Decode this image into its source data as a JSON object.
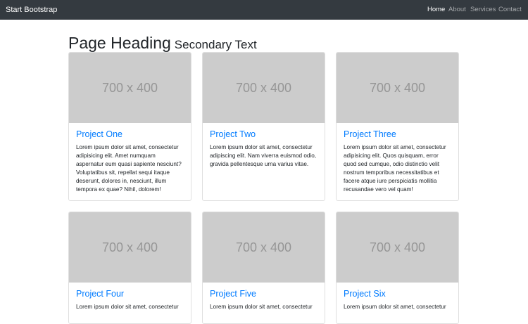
{
  "navbar": {
    "brand": "Start Bootstrap",
    "links": [
      {
        "label": "Home",
        "active": true
      },
      {
        "label": "About",
        "active": false
      },
      {
        "label": "Services",
        "active": false
      },
      {
        "label": "Contact",
        "active": false
      }
    ]
  },
  "page": {
    "heading": "Page Heading",
    "secondary": "Secondary Text"
  },
  "cards": [
    {
      "image_label": "700 x 400",
      "title": "Project One",
      "text": "Lorem ipsum dolor sit amet, consectetur adipisicing elit. Amet numquam aspernatur eum quasi sapiente nesciunt? Voluptatibus sit, repellat sequi itaque deserunt, dolores in, nesciunt, illum tempora ex quae? Nihil, dolorem!"
    },
    {
      "image_label": "700 x 400",
      "title": "Project Two",
      "text": "Lorem ipsum dolor sit amet, consectetur adipiscing elit. Nam viverra euismod odio, gravida pellentesque urna varius vitae."
    },
    {
      "image_label": "700 x 400",
      "title": "Project Three",
      "text": "Lorem ipsum dolor sit amet, consectetur adipisicing elit. Quos quisquam, error quod sed cumque, odio distinctio velit nostrum temporibus necessitatibus et facere atque iure perspiciatis mollitia recusandae vero vel quam!"
    },
    {
      "image_label": "700 x 400",
      "title": "Project Four",
      "text": "Lorem ipsum dolor sit amet, consectetur"
    },
    {
      "image_label": "700 x 400",
      "title": "Project Five",
      "text": "Lorem ipsum dolor sit amet, consectetur"
    },
    {
      "image_label": "700 x 400",
      "title": "Project Six",
      "text": "Lorem ipsum dolor sit amet, consectetur"
    }
  ],
  "colors": {
    "navbar_bg": "#343a40",
    "link_primary": "#007bff",
    "placeholder_bg": "#cccccc",
    "placeholder_text": "#969696"
  }
}
